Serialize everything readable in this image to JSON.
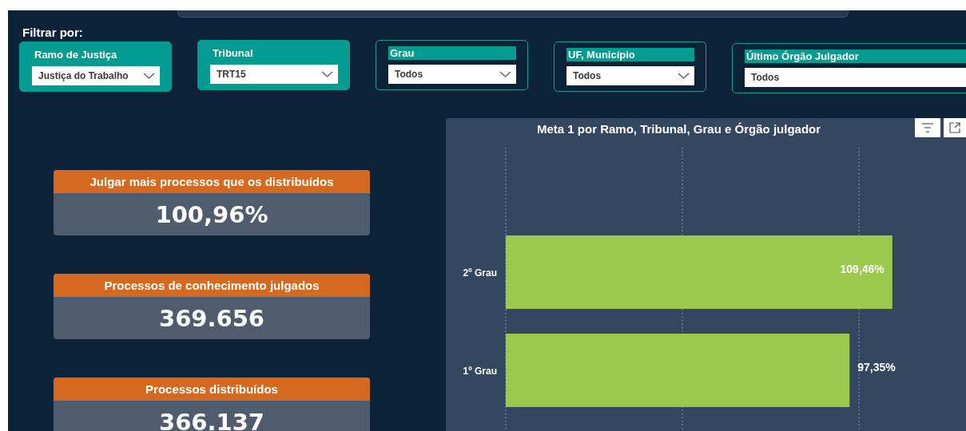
{
  "filter_heading": "Filtrar por:",
  "filters": [
    {
      "kind": "filled",
      "label": "Ramo de Justiça",
      "value": "Justiça do Trabalho",
      "chevron": true
    },
    {
      "kind": "filled",
      "label": "Tribunal",
      "value": "TRT15",
      "chevron": true
    },
    {
      "kind": "outlined",
      "label": "Grau",
      "value": "Todos",
      "chevron": true
    },
    {
      "kind": "outlined",
      "label": "UF, Município",
      "value": "Todos",
      "chevron": true
    },
    {
      "kind": "outlined",
      "label": "Último Órgão Julgador",
      "value": "Todos",
      "chevron": false
    }
  ],
  "kpis": [
    {
      "title": "Julgar mais processos que os distribuídos",
      "value": "100,96%"
    },
    {
      "title": "Processos de conhecimento julgados",
      "value": "369.656"
    },
    {
      "title": "Processos distribuídos",
      "value": "366.137"
    }
  ],
  "chart": {
    "chart_data": {
      "type": "bar",
      "orientation": "horizontal",
      "title": "Meta 1 por Ramo, Tribunal, Grau e Órgão julgador",
      "categories": [
        "2º Grau",
        "1º Grau"
      ],
      "values": [
        109.46,
        97.35
      ],
      "ref_lines": [
        {
          "axis": "x",
          "value": 0
        },
        {
          "axis": "x",
          "value": 50
        },
        {
          "axis": "x",
          "value": 100
        }
      ],
      "value_labels": [
        "109,46%",
        "97,35%"
      ]
    }
  }
}
